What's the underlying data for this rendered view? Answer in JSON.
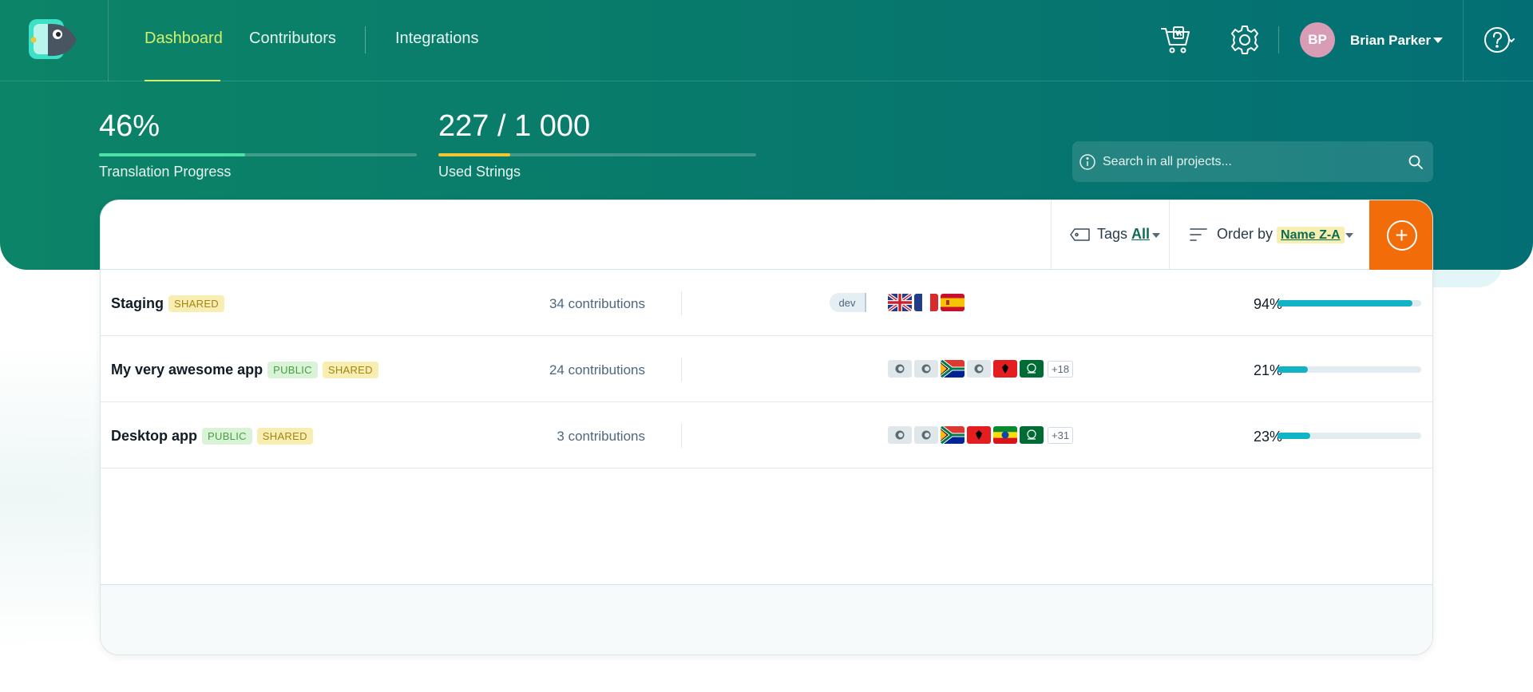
{
  "nav": {
    "links": [
      {
        "label": "Dashboard",
        "active": true
      },
      {
        "label": "Contributors",
        "active": false
      },
      {
        "label": "Integrations",
        "active": false
      }
    ],
    "icons": [
      "cart-icon",
      "gear-icon",
      "help-icon"
    ],
    "user": {
      "initials": "BP",
      "name": "Brian Parker",
      "avatar_color": "#d89cb4"
    }
  },
  "stats": {
    "translation": {
      "value": "46%",
      "label": "Translation Progress",
      "progress": 0.46,
      "color": "#4ee0a8"
    },
    "strings": {
      "value": "227 / 1 000",
      "label": "Used Strings",
      "progress": 0.227,
      "color": "#f2c531"
    }
  },
  "search": {
    "placeholder": "Search in all projects..."
  },
  "toolbar": {
    "tags_label": "Tags",
    "tags_value": "All",
    "order_label": "Order by",
    "order_value": "Name Z-A"
  },
  "projects": [
    {
      "name": "Staging",
      "badges": [
        "SHARED"
      ],
      "contributions": "34 contributions",
      "tag": "dev",
      "flags": [
        "gb",
        "fr",
        "es"
      ],
      "more": "",
      "percent": "94%",
      "progress": 0.94
    },
    {
      "name": "My very awesome app",
      "badges": [
        "PUBLIC",
        "SHARED"
      ],
      "contributions": "24 contributions",
      "tag": "",
      "flags": [
        "none",
        "none",
        "za",
        "none",
        "al",
        "sa"
      ],
      "more": "+18",
      "percent": "21%",
      "progress": 0.21
    },
    {
      "name": "Desktop app",
      "badges": [
        "PUBLIC",
        "SHARED"
      ],
      "contributions": "3 contributions",
      "tag": "",
      "flags": [
        "none",
        "none",
        "za",
        "al",
        "et",
        "sa"
      ],
      "more": "+31",
      "percent": "23%",
      "progress": 0.23
    }
  ],
  "colors": {
    "brand": "#0c8467",
    "accent": "#f26c0a",
    "progress": "#12b3c4"
  }
}
